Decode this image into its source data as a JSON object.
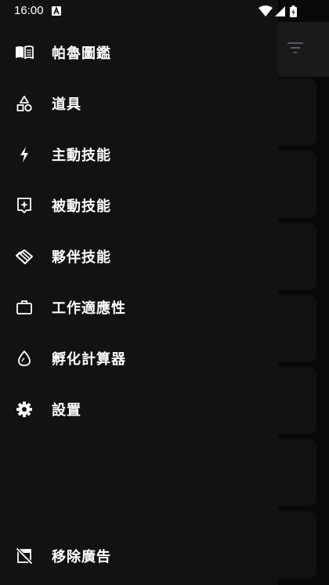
{
  "status_bar": {
    "time": "16:00"
  },
  "drawer": {
    "items": [
      {
        "label": "帕魯圖鑑",
        "icon": "book-icon"
      },
      {
        "label": "道具",
        "icon": "shapes-icon"
      },
      {
        "label": "主動技能",
        "icon": "lightning-icon"
      },
      {
        "label": "被動技能",
        "icon": "sparkle-box-icon"
      },
      {
        "label": "夥伴技能",
        "icon": "handshake-icon"
      },
      {
        "label": "工作適應性",
        "icon": "briefcase-icon"
      },
      {
        "label": "孵化計算器",
        "icon": "egg-icon"
      },
      {
        "label": "設置",
        "icon": "gear-icon"
      }
    ],
    "footer_item": {
      "label": "移除廣告",
      "icon": "no-ads-icon"
    }
  },
  "colors": {
    "drawer_bg": "#121214",
    "text": "#ffffff",
    "scrim": "#050505"
  }
}
